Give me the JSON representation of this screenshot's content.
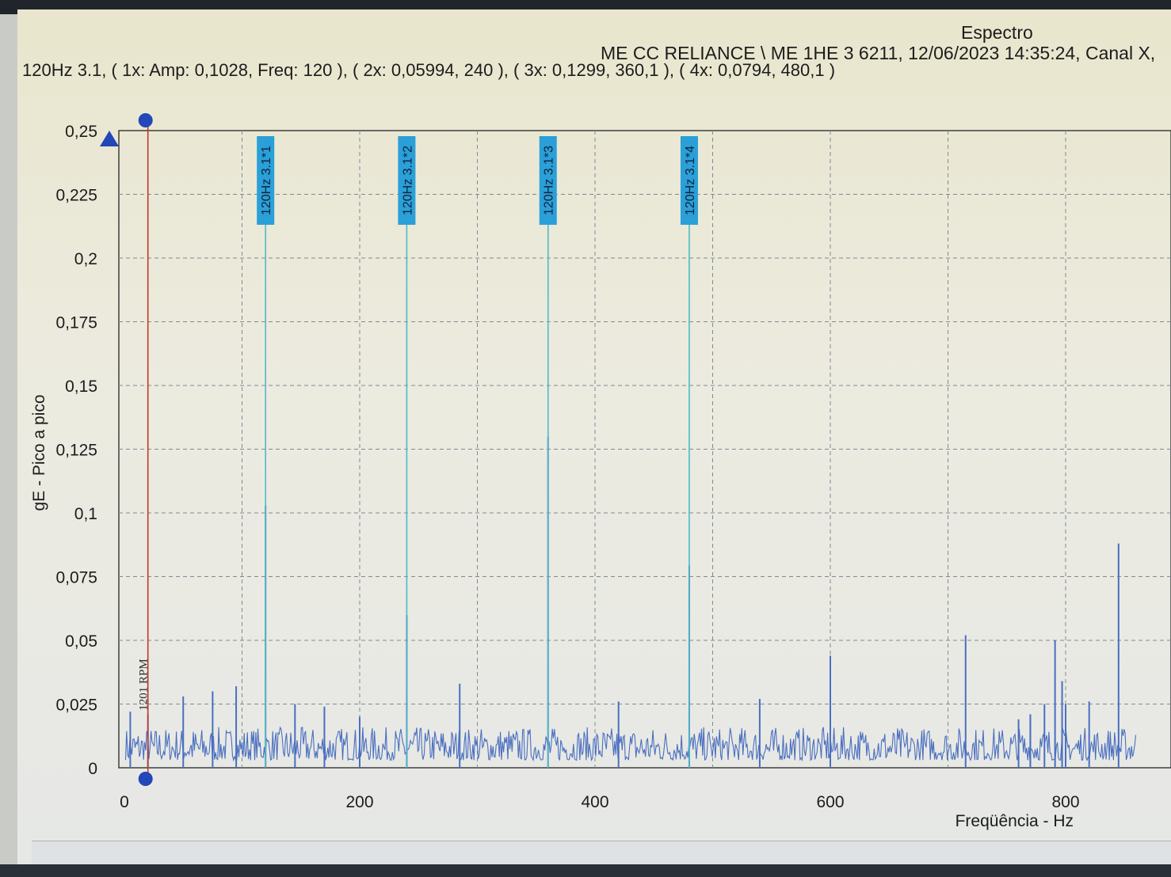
{
  "window": {
    "title": "Espectro",
    "machine_line": "ME CC RELIANCE \\ ME   1HE 3 6211, 12/06/2023 14:35:24, Canal X,",
    "summary_line": "120Hz 3.1, ( 1x: Amp: 0,1028, Freq: 120 ), ( 2x: 0,05994, 240 ), ( 3x: 0,1299, 360,1 ), ( 4x: 0,0794, 480,1 )"
  },
  "chart_data": {
    "type": "line",
    "title": "Espectro",
    "xlabel": "Freqüência - Hz",
    "ylabel": "gE - Pico a pico",
    "xlim": [
      0,
      860
    ],
    "ylim": [
      0,
      0.25
    ],
    "x_ticks": [
      {
        "value": 0,
        "label": "0"
      },
      {
        "value": 200,
        "label": "200"
      },
      {
        "value": 400,
        "label": "400"
      },
      {
        "value": 600,
        "label": "600"
      },
      {
        "value": 800,
        "label": "800"
      }
    ],
    "y_ticks": [
      {
        "value": 0,
        "label": "0"
      },
      {
        "value": 0.025,
        "label": "0,025"
      },
      {
        "value": 0.05,
        "label": "0,05"
      },
      {
        "value": 0.075,
        "label": "0,075"
      },
      {
        "value": 0.1,
        "label": "0,1"
      },
      {
        "value": 0.125,
        "label": "0,125"
      },
      {
        "value": 0.15,
        "label": "0,15"
      },
      {
        "value": 0.175,
        "label": "0,175"
      },
      {
        "value": 0.2,
        "label": "0,2"
      },
      {
        "value": 0.225,
        "label": "0,225"
      },
      {
        "value": 0.25,
        "label": "0,25"
      }
    ],
    "grid": true,
    "noise_floor": [
      0.003,
      0.016
    ],
    "peaks": [
      {
        "x": 5,
        "y": 0.022
      },
      {
        "x": 20,
        "y": 0.021
      },
      {
        "x": 50,
        "y": 0.028
      },
      {
        "x": 75,
        "y": 0.03
      },
      {
        "x": 95,
        "y": 0.032
      },
      {
        "x": 120,
        "y": 0.1028
      },
      {
        "x": 145,
        "y": 0.025
      },
      {
        "x": 170,
        "y": 0.024
      },
      {
        "x": 200,
        "y": 0.02
      },
      {
        "x": 240,
        "y": 0.05994
      },
      {
        "x": 285,
        "y": 0.033
      },
      {
        "x": 360.1,
        "y": 0.1299
      },
      {
        "x": 420,
        "y": 0.026
      },
      {
        "x": 480.1,
        "y": 0.0794
      },
      {
        "x": 540,
        "y": 0.027
      },
      {
        "x": 600,
        "y": 0.044
      },
      {
        "x": 715,
        "y": 0.052
      },
      {
        "x": 760,
        "y": 0.019
      },
      {
        "x": 770,
        "y": 0.02
      },
      {
        "x": 770,
        "y": 0.021
      },
      {
        "x": 782,
        "y": 0.025
      },
      {
        "x": 791,
        "y": 0.05
      },
      {
        "x": 797,
        "y": 0.034
      },
      {
        "x": 800,
        "y": 0.025
      },
      {
        "x": 820,
        "y": 0.026
      },
      {
        "x": 845,
        "y": 0.088
      }
    ],
    "harmonic_markers": [
      {
        "x": 120,
        "label": "120Hz 3.1*1"
      },
      {
        "x": 240,
        "label": "120Hz 3.1*2"
      },
      {
        "x": 360.1,
        "label": "120Hz 3.1*3"
      },
      {
        "x": 480.1,
        "label": "120Hz 3.1*4"
      }
    ],
    "rpm_cursor": {
      "x": 20,
      "label": "1201 RPM"
    },
    "colors": {
      "spectrum": "#4a6fc0",
      "marker_fill": "#2a9fd8",
      "marker_line": "#4fb9c9",
      "rpm_line": "#c0392b",
      "grid": "#7e8a96",
      "axis_marker": "#2346b8"
    }
  }
}
